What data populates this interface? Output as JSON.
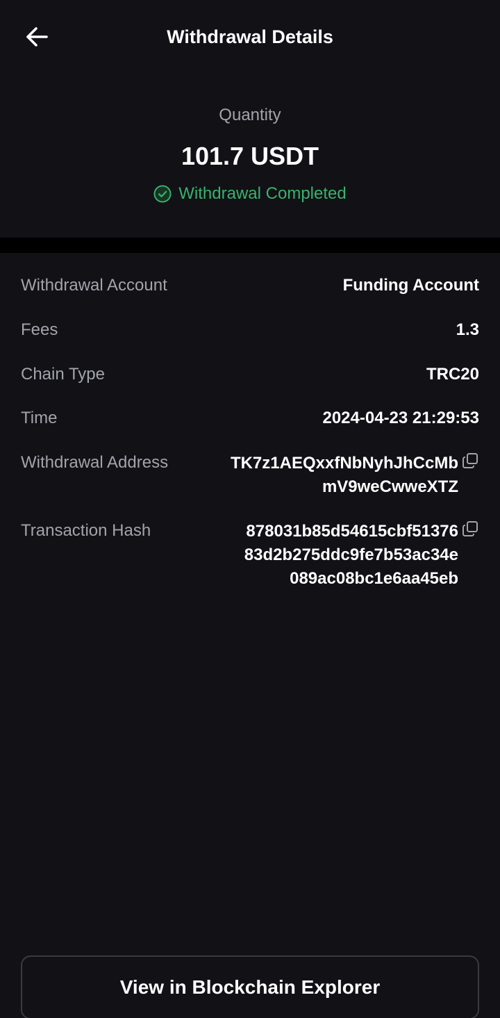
{
  "header": {
    "title": "Withdrawal Details",
    "back_icon": "arrow-left-icon"
  },
  "summary": {
    "quantity_label": "Quantity",
    "quantity_value": "101.7 USDT",
    "status_text": "Withdrawal Completed",
    "status_icon": "check-circle-icon",
    "status_color": "#3ab26c"
  },
  "details": {
    "withdrawal_account": {
      "label": "Withdrawal Account",
      "value": "Funding Account"
    },
    "fees": {
      "label": "Fees",
      "value": "1.3"
    },
    "chain_type": {
      "label": "Chain Type",
      "value": "TRC20"
    },
    "time": {
      "label": "Time",
      "value": "2024-04-23 21:29:53"
    },
    "withdrawal_address": {
      "label": "Withdrawal Address",
      "lines": [
        "TK7z1AEQxxfNbNyhJhCcMb",
        "mV9weCwweXTZ"
      ],
      "copy_icon": "copy-icon"
    },
    "transaction_hash": {
      "label": "Transaction Hash",
      "lines": [
        "878031b85d54615cbf51376",
        "83d2b275ddc9fe7b53ac34e",
        "089ac08bc1e6aa45eb"
      ],
      "copy_icon": "copy-icon"
    }
  },
  "footer": {
    "explorer_button_label": "View in Blockchain Explorer"
  },
  "colors": {
    "background": "#111116",
    "divider": "#000000",
    "label_gray": "#a3a4ab",
    "success_green": "#3ab26c"
  }
}
